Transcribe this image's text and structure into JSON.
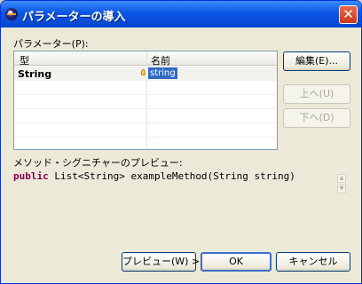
{
  "window": {
    "title": "パラメーターの導入"
  },
  "params": {
    "label": "パラメーター(P):",
    "columns": {
      "type": "型",
      "name": "名前"
    },
    "rows": [
      {
        "type": "String",
        "name": "string"
      }
    ]
  },
  "side_buttons": {
    "edit": "編集(E)...",
    "up": "上へ(U)",
    "down": "下へ(D)"
  },
  "preview": {
    "label": "メソッド・シグニチャーのプレビュー:",
    "keyword": "public",
    "signature": " List<String> exampleMethod(String string)"
  },
  "footer": {
    "preview_button": "プレビュー(W) >",
    "ok_button": "OK",
    "cancel_button": "キャンセル"
  },
  "icons": {
    "app": "eclipse-icon",
    "close": "close-icon",
    "hint": "lightbulb-icon"
  }
}
